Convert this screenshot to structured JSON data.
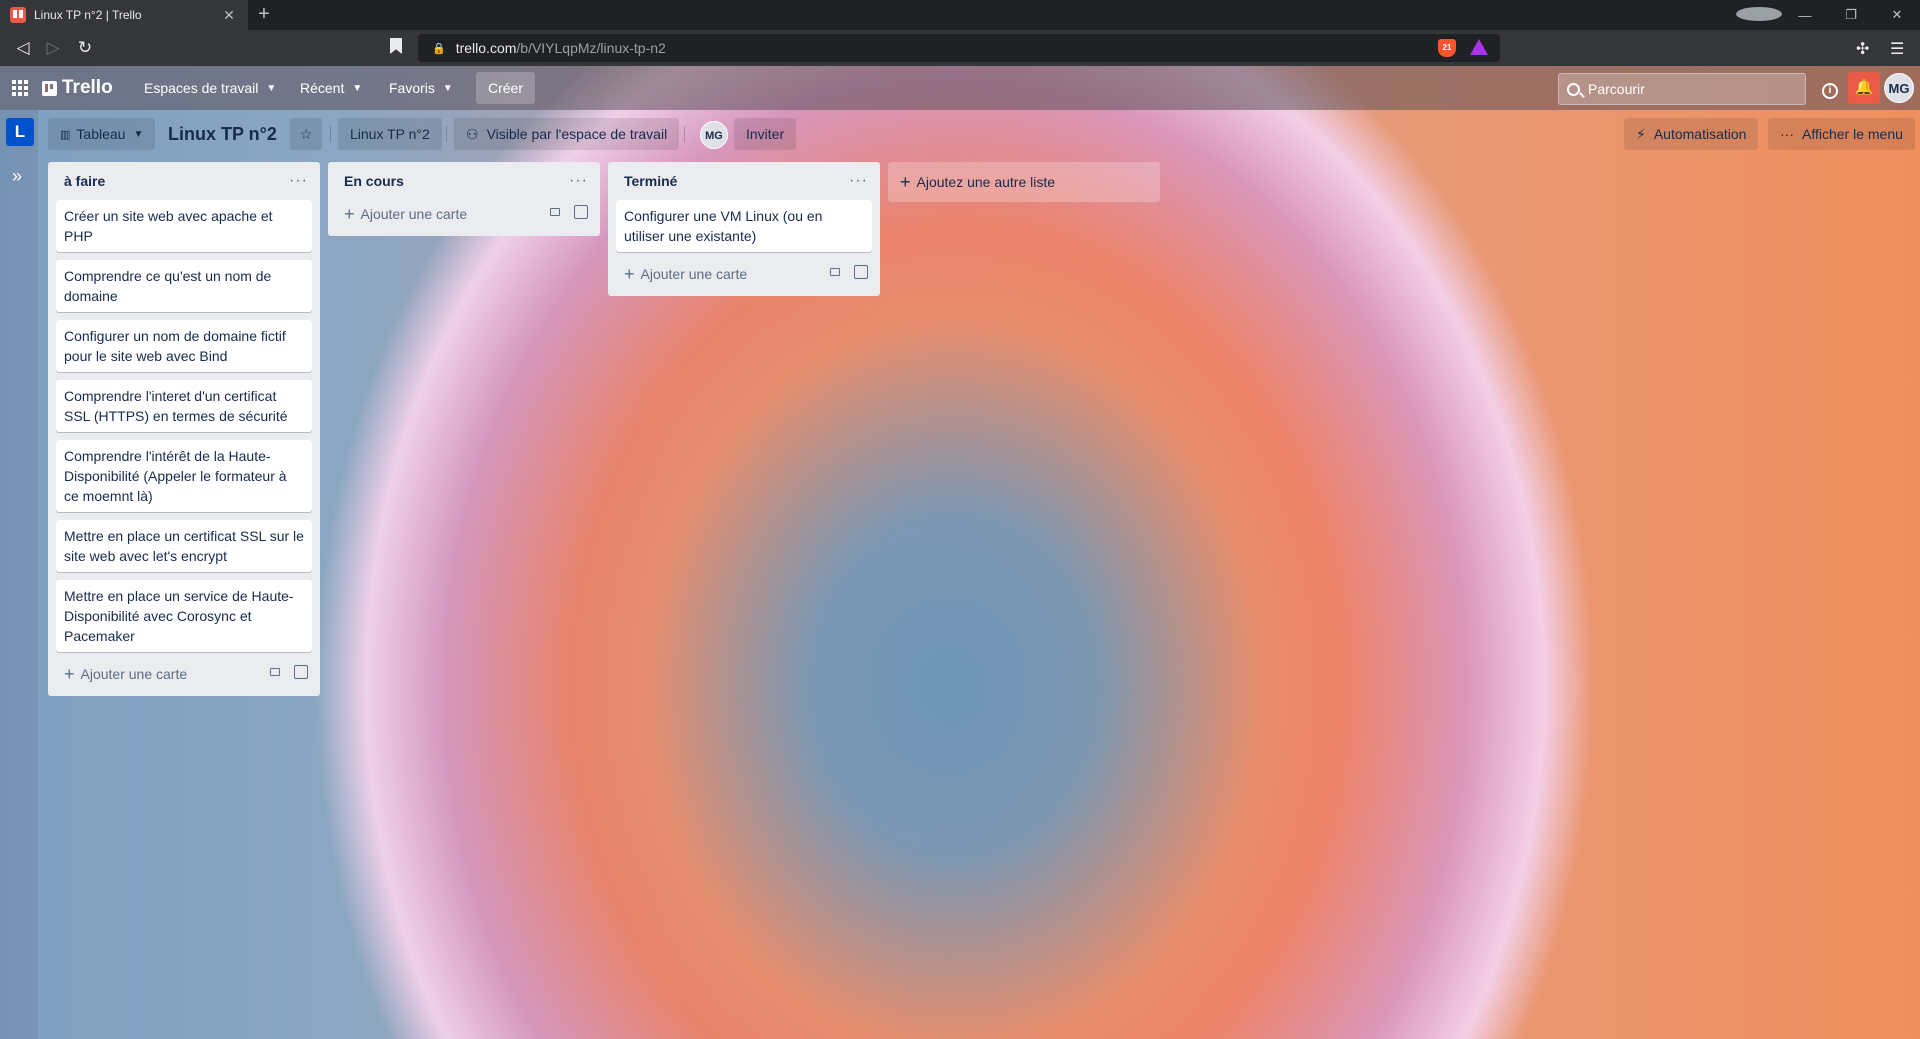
{
  "browser": {
    "tab_title": "Linux TP n°2 | Trello",
    "tab_close": "✕",
    "new_tab": "+",
    "url_host": "trello.com",
    "url_path": "/b/VIYLqpMz/linux-tp-n2",
    "shields_count": "21",
    "window_controls": [
      "—",
      "❐",
      "✕"
    ]
  },
  "header": {
    "logo": "Trello",
    "menus": [
      {
        "label": "Espaces de travail"
      },
      {
        "label": "Récent"
      },
      {
        "label": "Favoris"
      }
    ],
    "create_label": "Créer",
    "search_placeholder": "Parcourir",
    "avatar_initials": "MG"
  },
  "board": {
    "workspace_initial": "L",
    "view_label": "Tableau",
    "title": "Linux TP n°2",
    "workspace_name": "Linux TP n°2",
    "visibility": "Visible par l'espace de travail",
    "member_initials": "MG",
    "invite_label": "Inviter",
    "automation_label": "Automatisation",
    "menu_label": "Afficher le menu",
    "add_list_label": "Ajoutez une autre liste",
    "add_card_label": "Ajouter une carte",
    "lists": [
      {
        "title": "à faire",
        "cards": [
          "Créer un site web avec apache et PHP",
          "Comprendre ce qu'est un nom de domaine",
          "Configurer un nom de domaine fictif pour le site web avec Bind",
          "Comprendre l'interet d'un certificat SSL (HTTPS) en termes de sécurité",
          "Comprendre l'intérêt de la Haute-Disponibilité (Appeler le formateur à ce moemnt là)",
          "Mettre en place un certificat SSL sur le site web avec let's encrypt",
          "Mettre en place un service de Haute-Disponibilité avec Corosync et Pacemaker"
        ]
      },
      {
        "title": "En cours",
        "cards": []
      },
      {
        "title": "Terminé",
        "cards": [
          "Configurer une VM Linux (ou en utiliser une existante)"
        ]
      }
    ]
  },
  "colors": {
    "accent": "#0052cc",
    "notification": "#eb5a46",
    "list_bg": "#ebecf0"
  }
}
